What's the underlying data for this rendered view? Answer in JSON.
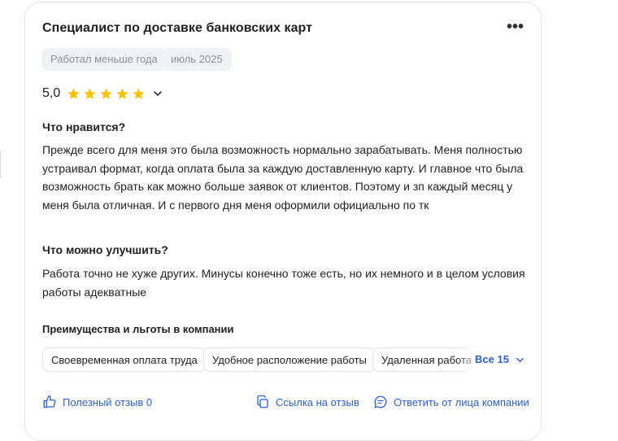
{
  "review": {
    "title": "Специалист по доставке банковских карт",
    "tags": [
      "Работал меньше года",
      "июль 2025"
    ],
    "rating": "5,0",
    "stars": 5,
    "likes_heading": "Что нравится?",
    "likes_text": "Прежде всего для меня это была возможность нормально зарабатывать. Меня полностью устраивал формат, когда оплата была за каждую доставленную карту. И главное что была возможность брать как можно больше заявок от клиентов. Поэтому и зп каждый месяц у меня была отличная. И с первого дня меня оформили официально по тк",
    "improve_heading": "Что можно улучшить?",
    "improve_text": "Работа точно не хуже других. Минусы конечно тоже есть, но их немного и в целом условия работы адекватные"
  },
  "benefits": {
    "heading": "Преимущества и льготы в компании",
    "items": [
      "Своевременная оплата труда",
      "Удобное расположение работы",
      "Удаленная работа"
    ],
    "all_label": "Все 15"
  },
  "actions": {
    "useful": "Полезный отзыв 0",
    "copy_link": "Ссылка на отзыв",
    "reply": "Ответить от лица компании"
  },
  "colors": {
    "accent": "#2b5fd9",
    "star": "#ffc107",
    "chip_bg": "#f1f2f5"
  }
}
